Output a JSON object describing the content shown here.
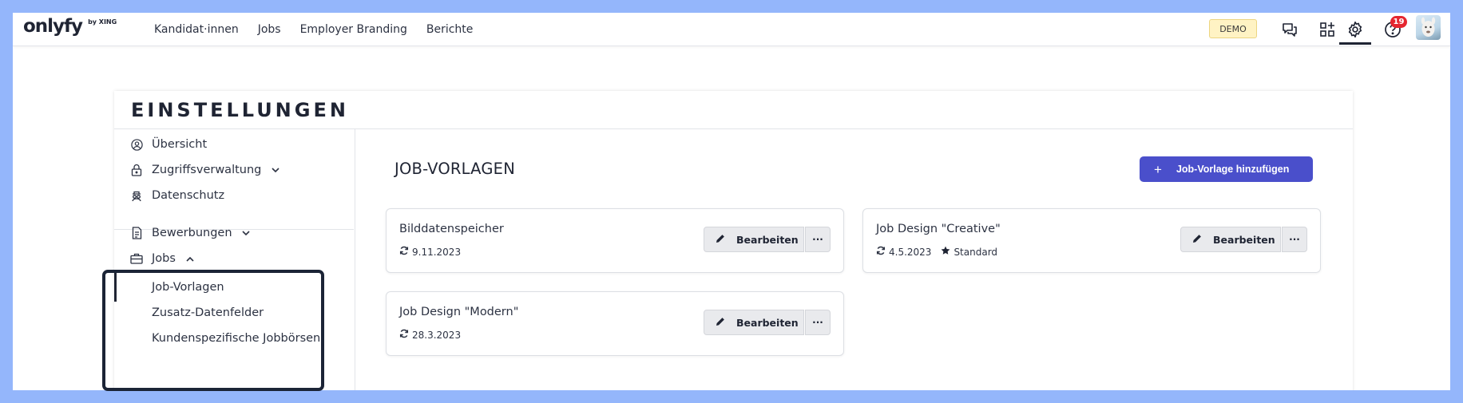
{
  "app": {
    "logo_text": "onlyfy",
    "logo_sub": "by XING",
    "nav": [
      "Kandidat·innen",
      "Jobs",
      "Employer Branding",
      "Berichte"
    ],
    "demo_label": "DEMO",
    "notification_count": "19",
    "icons": [
      "chat-icon",
      "apps-add-icon",
      "gear-icon",
      "help-icon"
    ]
  },
  "settings": {
    "title": "EINSTELLUNGEN",
    "sidebar": {
      "overview": "Übersicht",
      "access": "Zugriffsverwaltung",
      "privacy": "Datenschutz",
      "applications": "Bewerbungen",
      "jobs": "Jobs",
      "job_templates": "Job-Vorlagen",
      "extra_fields": "Zusatz-Datenfelder",
      "custom_boards": "Kundenspezifische Jobbörsen"
    }
  },
  "main": {
    "title": "JOB-VORLAGEN",
    "add_label": "Job-Vorlage hinzufügen",
    "edit_label": "Bearbeiten",
    "more_label": "···",
    "templates": [
      {
        "name": "Bilddatenspeicher",
        "date": "9.11.2023",
        "badge": ""
      },
      {
        "name": "Job Design \"Creative\"",
        "date": "4.5.2023",
        "badge": "Standard"
      },
      {
        "name": "Job Design \"Modern\"",
        "date": "28.3.2023",
        "badge": ""
      }
    ]
  },
  "colors": {
    "frame": "#94b6fb",
    "primary": "#4a4fcb",
    "badge_red": "#e5262f",
    "demo_bg": "#fff3c4",
    "text": "#1f2433"
  }
}
